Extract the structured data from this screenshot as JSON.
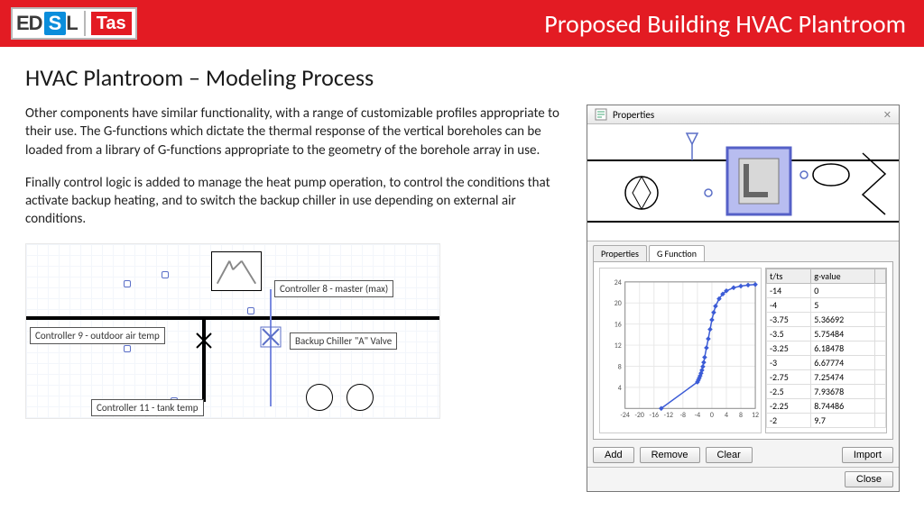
{
  "banner": {
    "logo_ed": "ED",
    "logo_s": "S",
    "logo_l": "L",
    "logo_tas": "Tas",
    "title": "Proposed Building HVAC Plantroom"
  },
  "page_heading": "HVAC Plantroom – Modeling Process",
  "paragraphs": [
    "Other components have similar functionality, with a range of customizable profiles appropriate to their use. The G-functions which dictate the thermal response of the vertical boreholes can be loaded from a library of G-functions appropriate to the geometry of the borehole array in use.",
    "Finally control logic is added to manage the heat pump operation, to control the conditions that activate backup heating, and to switch the backup chiller in use depending on external air conditions."
  ],
  "schematic_labels": {
    "ctrl8": "Controller 8 - master (max)",
    "ctrl9": "Controller 9 - outdoor air temp",
    "backup": "Backup Chiller \"A\" Valve",
    "ctrl11": "Controller 11 - tank temp"
  },
  "panel": {
    "title": "Properties",
    "tabs": {
      "properties": "Properties",
      "gfunction": "G Function"
    },
    "table_headers": {
      "tts": "t/ts",
      "gvalue": "g-value"
    },
    "buttons": {
      "add": "Add",
      "remove": "Remove",
      "clear": "Clear",
      "import": "Import",
      "close": "Close"
    }
  },
  "chart_data": {
    "type": "line",
    "title": "",
    "xlabel": "",
    "ylabel": "",
    "xlim": [
      -24,
      12
    ],
    "ylim": [
      0,
      24
    ],
    "xticks": [
      -24,
      -20,
      -16,
      -12,
      -8,
      -4,
      0,
      4,
      8,
      12
    ],
    "yticks": [
      4,
      8,
      12,
      16,
      20,
      24
    ],
    "series": [
      {
        "name": "g-value",
        "x": [
          -14,
          -4,
          -3.75,
          -3.5,
          -3.25,
          -3,
          -2.75,
          -2.5,
          -2.25,
          -2,
          -1.5,
          -1,
          -0.5,
          0,
          0.5,
          1,
          2,
          3,
          4,
          6,
          8,
          10,
          12
        ],
        "y": [
          0,
          5,
          5.37,
          5.75,
          6.18,
          6.68,
          7.25,
          7.94,
          8.74,
          9.7,
          11.5,
          13.2,
          15.0,
          16.8,
          18.2,
          19.4,
          20.8,
          21.7,
          22.3,
          22.9,
          23.2,
          23.4,
          23.5
        ]
      }
    ],
    "table_rows": [
      {
        "tts": "-14",
        "g": "0"
      },
      {
        "tts": "-4",
        "g": "5"
      },
      {
        "tts": "-3.75",
        "g": "5.36692"
      },
      {
        "tts": "-3.5",
        "g": "5.75484"
      },
      {
        "tts": "-3.25",
        "g": "6.18478"
      },
      {
        "tts": "-3",
        "g": "6.67774"
      },
      {
        "tts": "-2.75",
        "g": "7.25474"
      },
      {
        "tts": "-2.5",
        "g": "7.93678"
      },
      {
        "tts": "-2.25",
        "g": "8.74486"
      },
      {
        "tts": "-2",
        "g": "9.7"
      }
    ]
  }
}
